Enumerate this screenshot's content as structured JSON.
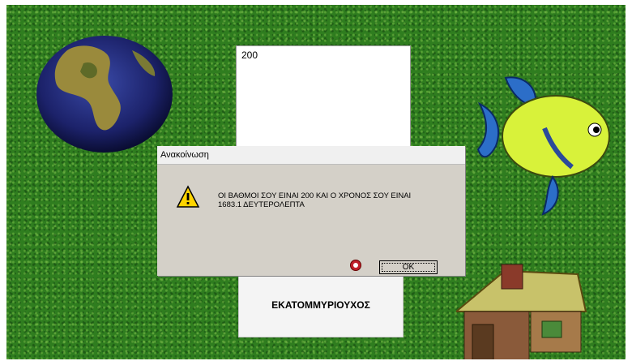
{
  "textbox": {
    "value": "200"
  },
  "label": {
    "text": "ΕΚΑΤΟΜΜΥΡΙΟΥΧΟΣ"
  },
  "dialog": {
    "title": "Ανακοίνωση",
    "message_line1": "ΟΙ ΒΑΘΜΟΙ ΣΟΥ ΕΙΝΑΙ 200 ΚΑΙ Ο ΧΡΟΝΟΣ ΣΟΥ ΕΙΝΑΙ",
    "message_line2": "1683.1 ΔΕΥΤΕΡΟΛΕΠΤΑ",
    "ok_label": "OK",
    "icon": "warning-icon"
  },
  "colors": {
    "grass": "#2f7d1f",
    "dialog_bg": "#d4d0c8",
    "fish_body": "#d8f23a",
    "warning": "#ffd400"
  }
}
